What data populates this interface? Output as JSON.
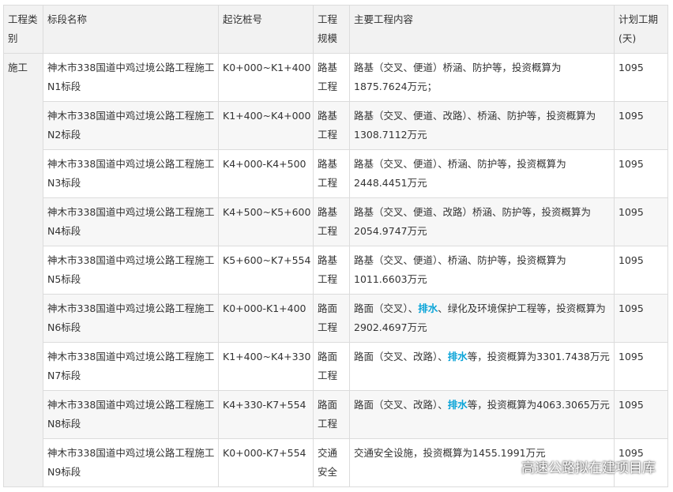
{
  "headers": {
    "category": "工程类别",
    "name": "标段名称",
    "stake": "起讫桩号",
    "scale": "工程规模",
    "content": "主要工程内容",
    "period": "计划工期(天)"
  },
  "category_value": "施工",
  "rows": [
    {
      "name": "神木市338国道中鸡过境公路工程施工N1标段",
      "stake": "K0+000~K1+400",
      "scale": "路基工程",
      "content": "路基（交叉、便道）桥涵、防护等，投资概算为1875.7624万元；",
      "period": "1095"
    },
    {
      "name": "神木市338国道中鸡过境公路工程施工N2标段",
      "stake": "K1+400~K4+000",
      "scale": "路基工程",
      "content": "路基（交叉、便道、改路）、桥涵、防护等，投资概算为1308.7112万元",
      "period": "1095"
    },
    {
      "name": "神木市338国道中鸡过境公路工程施工N3标段",
      "stake": "K4+000-K4+500",
      "scale": "路基工程",
      "content": "路基（交叉、便道）、桥涵、防护等，投资概算为2448.4451万元",
      "period": "1095"
    },
    {
      "name": "神木市338国道中鸡过境公路工程施工N4标段",
      "stake": "K4+500~K5+600",
      "scale": "路基工程",
      "content": "路基（交叉、便道、改路）桥涵、防护等，投资概算为2054.9747万元",
      "period": "1095"
    },
    {
      "name": "神木市338国道中鸡过境公路工程施工N5标段",
      "stake": "K5+600~K7+554",
      "scale": "路基工程",
      "content": "路基（交叉、便道）、桥涵、防护等，投资概算为1011.6603万元",
      "period": "1095"
    },
    {
      "name": "神木市338国道中鸡过境公路工程施工N6标段",
      "stake": "K0+000-K1+400",
      "scale": "路面工程",
      "content_pre": "路面（交叉）、",
      "content_hl": "排水",
      "content_post": "、绿化及环境保护工程等，投资概算为2902.4697万元",
      "period": "1095"
    },
    {
      "name": "神木市338国道中鸡过境公路工程施工N7标段",
      "stake": "K1+400~K4+330",
      "scale": "路面工程",
      "content_pre": "路面（交叉、改路）、",
      "content_hl": "排水",
      "content_post": "等，投资概算为3301.7438万元",
      "period": "1095"
    },
    {
      "name": "神木市338国道中鸡过境公路工程施工N8标段",
      "stake": "K4+330-K7+554",
      "scale": "路面工程",
      "content_pre": "路面（交叉、改路）、",
      "content_hl": "排水",
      "content_post": "等，投资概算为4063.3065万元",
      "period": "1095"
    },
    {
      "name": "神木市338国道中鸡过境公路工程施工N9标段",
      "stake": "K0+000-K7+554",
      "scale": "交通安全",
      "content": "交通安全设施，投资概算为1455.1991万元",
      "period": "1095"
    }
  ],
  "watermark": {
    "text": "高速公路拟在建项目库",
    "icon": "wechat-icon"
  }
}
